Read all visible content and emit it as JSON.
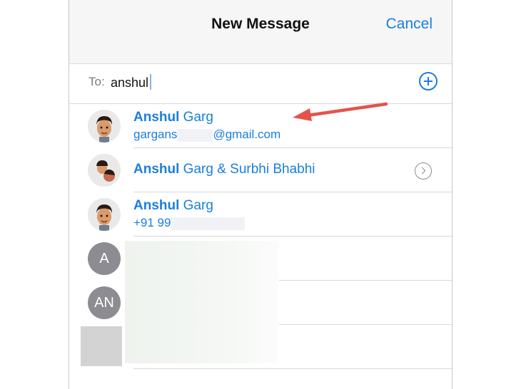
{
  "header": {
    "title": "New Message",
    "cancel_label": "Cancel"
  },
  "to_field": {
    "label": "To:",
    "value": "anshul"
  },
  "contacts": [
    {
      "name_bold": "Anshul",
      "name_rest": " Garg",
      "sub_pre": "gargans",
      "sub_post": "@gmail.com",
      "avatar": "memoji"
    },
    {
      "name_bold": "Anshul",
      "name_rest": " Garg & Surbhi Bhabhi",
      "avatar": "group-memoji"
    },
    {
      "name_bold": "Anshul",
      "name_rest": " Garg",
      "sub_pre": "+91 99",
      "sub_post": "",
      "avatar": "memoji"
    },
    {
      "initials": "A"
    },
    {
      "initials": "AN"
    },
    {
      "avatar": "photo"
    }
  ],
  "icons": {
    "add": "plus-circle-icon",
    "info": "chevron-right-circle-icon",
    "annotation": "red-arrow-icon"
  },
  "colors": {
    "accent": "#1a7ee0",
    "annotation": "#e5534b"
  }
}
